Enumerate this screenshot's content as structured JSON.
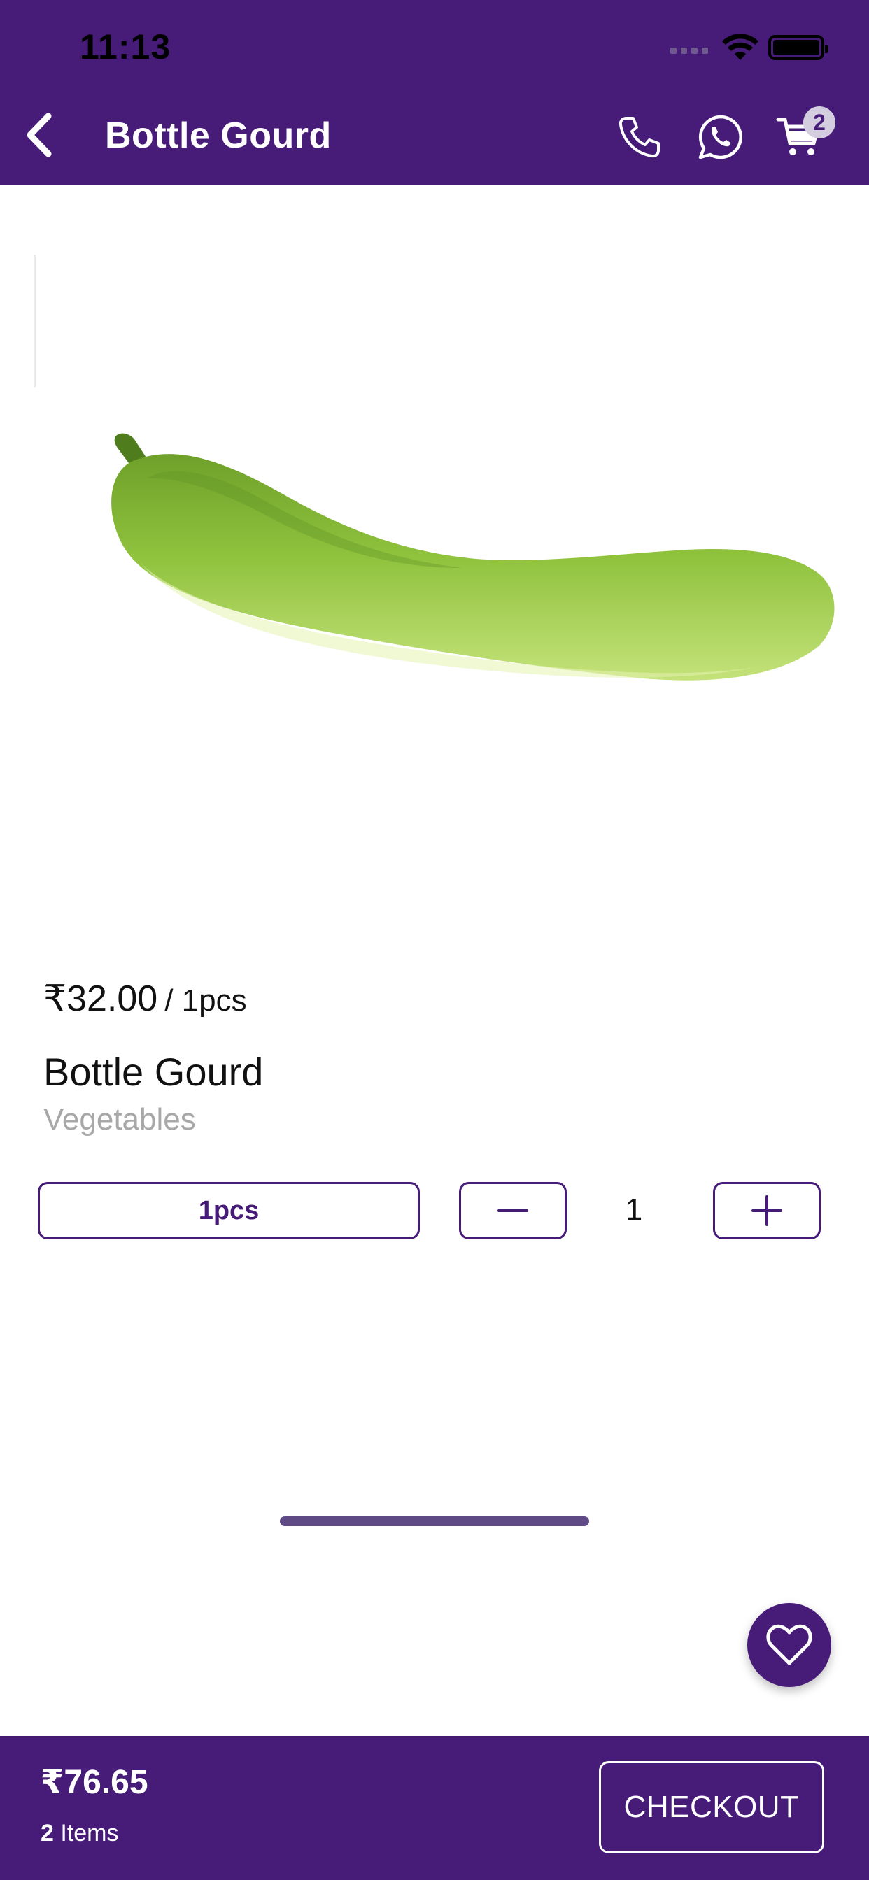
{
  "status_bar": {
    "time": "11:13"
  },
  "header": {
    "title": "Bottle Gourd",
    "cart_count": "2"
  },
  "product": {
    "price": "₹32.00",
    "unit": "/ 1pcs",
    "name": "Bottle Gourd",
    "category": "Vegetables",
    "variant": "1pcs",
    "quantity": "1"
  },
  "footer": {
    "total": "₹76.65",
    "item_count": "2",
    "items_label": "Items",
    "checkout_label": "CHECKOUT"
  },
  "colors": {
    "brand": "#471b78",
    "image_green": "#8fc23d"
  },
  "icons": [
    "back-arrow-icon",
    "phone-icon",
    "whatsapp-icon",
    "cart-icon",
    "minus-icon",
    "plus-icon",
    "heart-icon"
  ]
}
